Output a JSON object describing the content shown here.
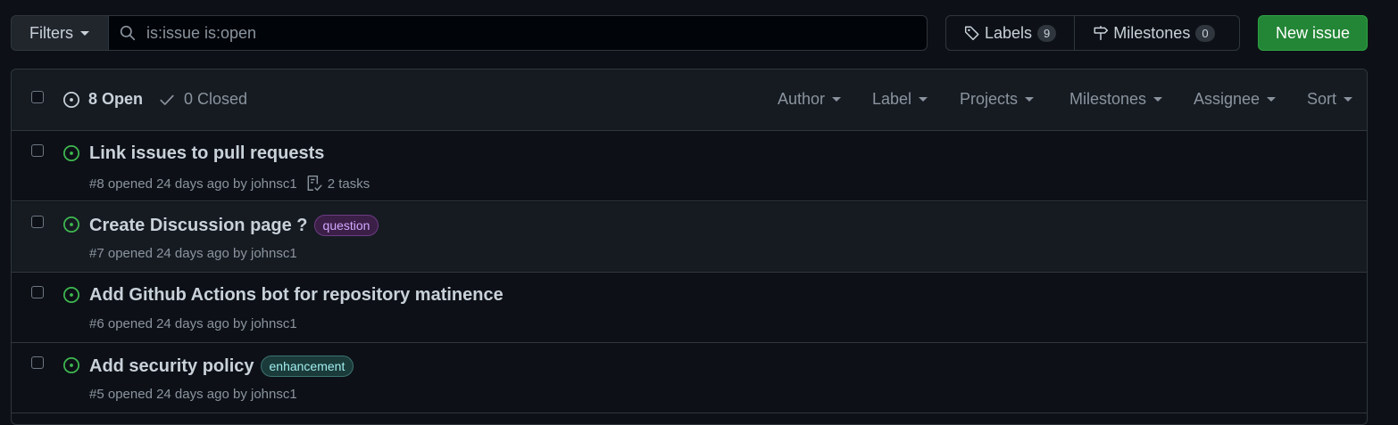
{
  "toolbar": {
    "filters_label": "Filters",
    "search_value": "is:issue is:open",
    "labels_label": "Labels",
    "labels_count": "9",
    "milestones_label": "Milestones",
    "milestones_count": "0",
    "new_issue_label": "New issue"
  },
  "header": {
    "open_label": "8 Open",
    "closed_label": "0 Closed",
    "filters": [
      "Author",
      "Label",
      "Projects",
      "Milestones",
      "Assignee",
      "Sort"
    ]
  },
  "issues": [
    {
      "title": "Link issues to pull requests",
      "meta": "#8 opened 24 days ago by johnsc1",
      "tasks": "2 tasks",
      "label": ""
    },
    {
      "title": "Create Discussion page ?",
      "meta": "#7 opened 24 days ago by johnsc1",
      "tasks": "",
      "label": "question"
    },
    {
      "title": "Add Github Actions bot for repository matinence",
      "meta": "#6 opened 24 days ago by johnsc1",
      "tasks": "",
      "label": ""
    },
    {
      "title": "Add security policy",
      "meta": "#5 opened 24 days ago by johnsc1",
      "tasks": "",
      "label": "enhancement"
    }
  ],
  "colors": {
    "open_icon": "#3fb950",
    "new_issue_bg": "#238636"
  },
  "icons": {
    "search": "search-icon",
    "labels": "tag-icon",
    "milestones": "milestone-icon",
    "open": "issue-opened-icon",
    "closed": "check-icon",
    "tasks": "checklist-icon"
  }
}
